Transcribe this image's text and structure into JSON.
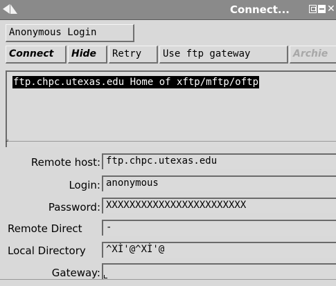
{
  "window": {
    "title": "Connect..."
  },
  "toolbar": {
    "anonymous_login": "Anonymous Login",
    "connect": "Connect",
    "hide": "Hide",
    "retry": "Retry",
    "use_ftp_gateway": "Use ftp gateway",
    "archie": "Archie"
  },
  "host_list": {
    "selected_entry": "ftp.chpc.utexas.edu Home of xftp/mftp/oftp"
  },
  "form": {
    "remote_host": {
      "label": "Remote host:",
      "value": "ftp.chpc.utexas.edu"
    },
    "login": {
      "label": "Login:",
      "value": "anonymous"
    },
    "password": {
      "label": "Password:",
      "value": "XXXXXXXXXXXXXXXXXXXXXXXX"
    },
    "remote_directory": {
      "label": "Remote Direct",
      "value": "-"
    },
    "local_directory": {
      "label": "Local Directory",
      "value": "^XÌ'@^XÌ'@"
    },
    "gateway": {
      "label": "Gateway:",
      "value": ""
    }
  }
}
